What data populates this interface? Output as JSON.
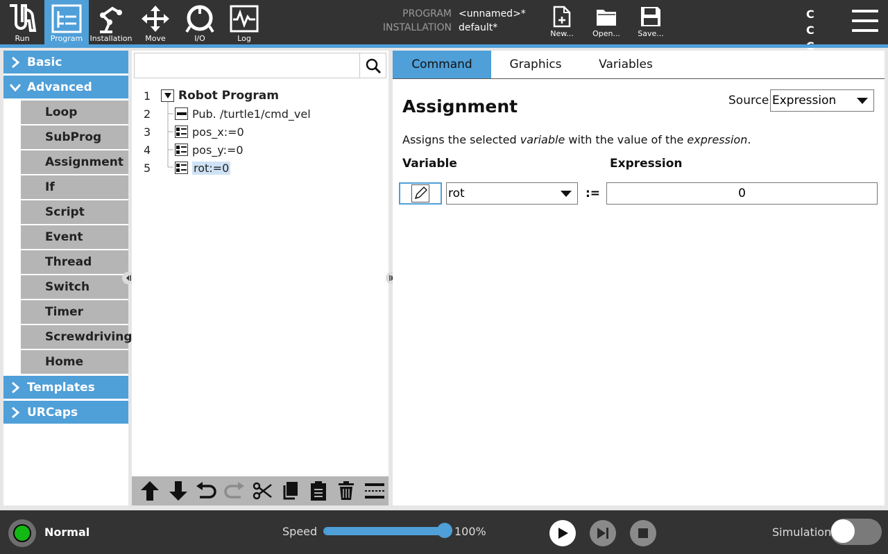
{
  "topbar": {
    "nav": [
      {
        "label": "Run",
        "icon": "ur-logo-icon"
      },
      {
        "label": "Program",
        "icon": "program-tree-icon",
        "active": true
      },
      {
        "label": "Installation",
        "icon": "robot-arm-icon"
      },
      {
        "label": "Move",
        "icon": "move-arrows-icon"
      },
      {
        "label": "I/O",
        "icon": "io-icon"
      },
      {
        "label": "Log",
        "icon": "log-icon"
      }
    ],
    "program_key": "PROGRAM",
    "program_value": "<unnamed>*",
    "installation_key": "INSTALLATION",
    "installation_value": "default*",
    "new_label": "New...",
    "open_label": "Open...",
    "save_label": "Save...",
    "cc_row1": "C C",
    "cc_row2": "C C"
  },
  "left_panel": {
    "basic": "Basic",
    "advanced": "Advanced",
    "advanced_items": [
      "Loop",
      "SubProg",
      "Assignment",
      "If",
      "Script",
      "Event",
      "Thread",
      "Switch",
      "Timer",
      "Screwdriving",
      "Home"
    ],
    "templates": "Templates",
    "urcaps": "URCaps"
  },
  "tree": {
    "search_placeholder": "",
    "lines": [
      {
        "num": "1",
        "label": "Robot Program"
      },
      {
        "num": "2",
        "label": "Pub. /turtle1/cmd_vel"
      },
      {
        "num": "3",
        "label": "pos_x:=0"
      },
      {
        "num": "4",
        "label": "pos_y:=0"
      },
      {
        "num": "5",
        "label": "rot:=0"
      }
    ]
  },
  "right_panel": {
    "tabs": [
      "Command",
      "Graphics",
      "Variables"
    ],
    "active_tab": "Command",
    "title": "Assignment",
    "source_label": "Source",
    "source_value": "Expression",
    "desc_1": "Assigns the selected ",
    "desc_var": "variable",
    "desc_2": " with the value of the ",
    "desc_expr": "expression",
    "desc_3": ".",
    "variable_header": "Variable",
    "expression_header": "Expression",
    "variable_value": "rot",
    "assign_op": ":=",
    "expression_value": "0"
  },
  "bottombar": {
    "status": "Normal",
    "speed_label": "Speed",
    "speed_value": "100%",
    "speed_fraction": 1.0,
    "simulation_label": "Simulation",
    "simulation_on": false
  },
  "colors": {
    "accent": "#4f9fd8",
    "bar_bg": "#333333",
    "status_green": "#14b814"
  }
}
